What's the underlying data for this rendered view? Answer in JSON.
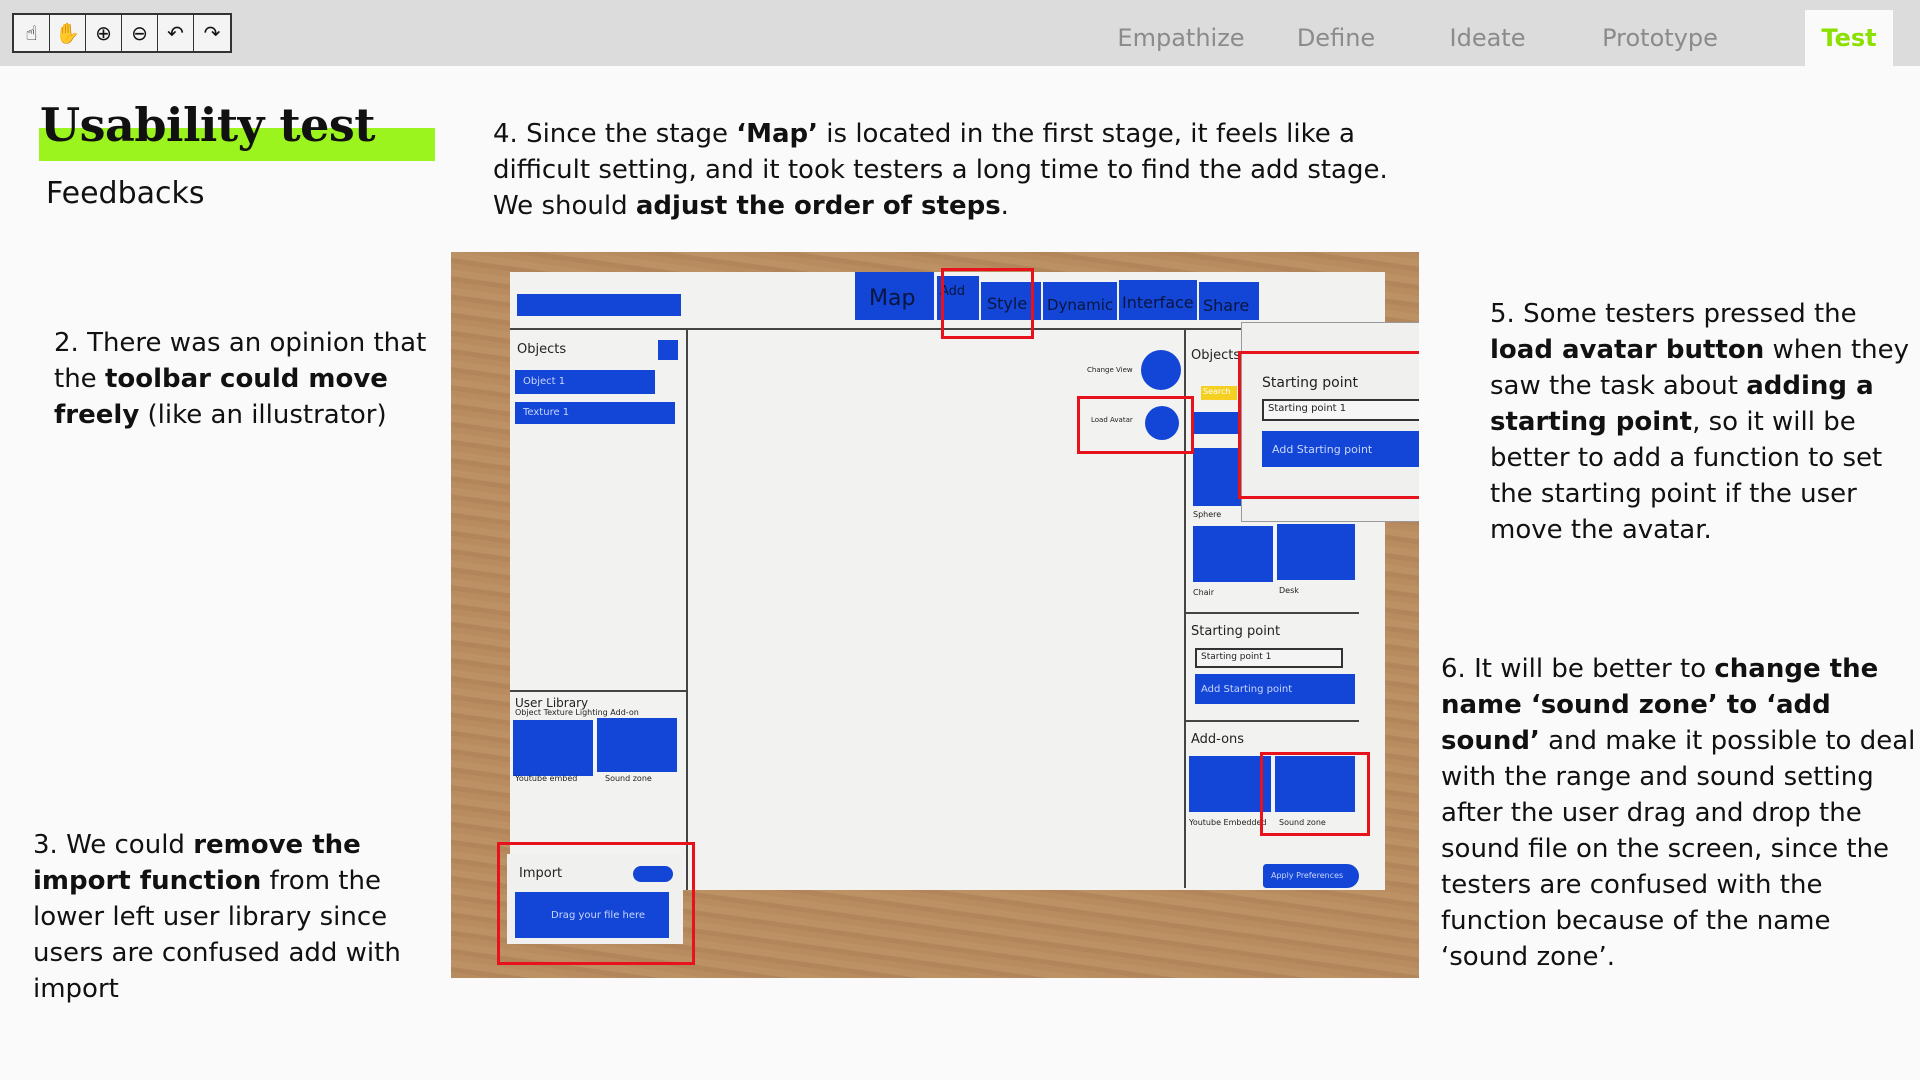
{
  "toolbar": {
    "tools": [
      {
        "name": "pointer-hand-icon",
        "glyph": "☝"
      },
      {
        "name": "pan-hand-icon",
        "glyph": "✋"
      },
      {
        "name": "zoom-in-icon",
        "glyph": "⊕"
      },
      {
        "name": "zoom-out-icon",
        "glyph": "⊖"
      },
      {
        "name": "undo-icon",
        "glyph": "↶"
      },
      {
        "name": "redo-icon",
        "glyph": "↷"
      }
    ]
  },
  "stages": [
    "Empathize",
    "Define",
    "Ideate",
    "Prototype",
    "Test"
  ],
  "active_stage": "Test",
  "accent_color": "#9cf41e",
  "title": "Usability test",
  "subtitle": "Feedbacks",
  "notes": {
    "n4": "4. Since the stage <b>‘Map’</b> is located in the first stage, it feels like a difficult setting, and it took testers a long time to find the add stage. We should <b>adjust the order of steps</b>.",
    "n2": "2. There was an opinion that the <b>toolbar could move freely</b> (like an illustrator)",
    "n3": "3. We could <b>remove the import function</b> from the lower left user library since users are confused add with import",
    "n5": "5. Some testers pressed the <b>load avatar button</b> when they saw the task about <b>adding a starting point</b>, so it will be better to add a function to set the starting point if the user move the avatar.",
    "n6": "6. It will be better to <b>change the name ‘sound zone’ to ‘add sound’</b> and make it possible to deal with the range and sound setting after the user drag and drop the sound file on the screen, since the testers are confused with the function because of the name ‘sound zone’."
  },
  "photo": {
    "top_tabs": [
      "Map",
      "Add",
      "Style",
      "Dynamic",
      "Interface",
      "Share"
    ],
    "left_panel": {
      "objects_label": "Objects",
      "items": [
        "Object 1",
        "Texture 1"
      ],
      "user_library_label": "User Library",
      "library_tabs": "Object  Texture  Lighting  Add-on",
      "library_items": [
        "Youtube embed",
        "Sound zone"
      ],
      "import_label": "Import",
      "import_drop": "Drag your file here"
    },
    "canvas_labels": {
      "change_view": "Change View",
      "load_avatar": "Load Avatar"
    },
    "right_panel": {
      "objects_label": "Objects",
      "search": "Search",
      "objects": [
        "Sphere",
        "Chair",
        "Desk"
      ],
      "starting_point_label": "Starting point",
      "starting_point_value": "Starting point 1",
      "add_starting_point": "Add Starting point",
      "addons_label": "Add-ons",
      "addons": [
        "Youtube Embedded",
        "Sound zone"
      ],
      "apply": "Apply Preferences"
    }
  }
}
